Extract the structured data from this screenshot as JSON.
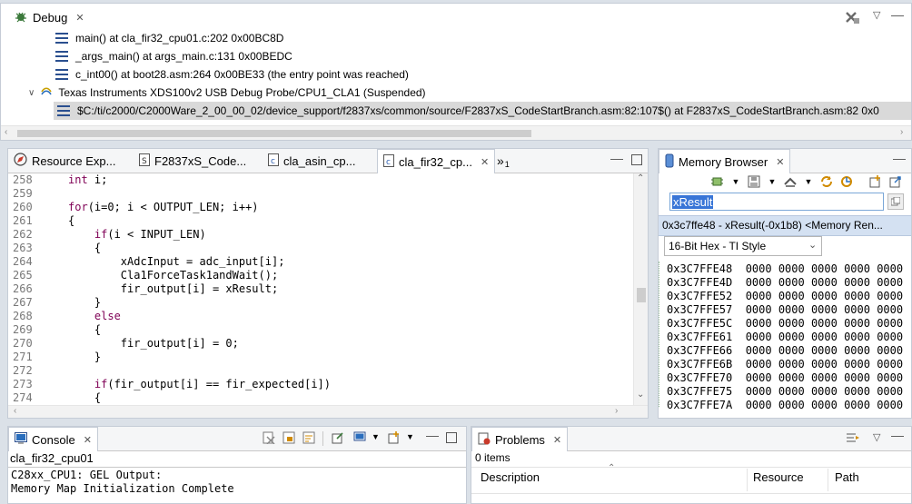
{
  "debug": {
    "tab_label": "Debug",
    "frames": [
      "main() at cla_fir32_cpu01.c:202 0x00BC8D",
      "_args_main() at args_main.c:131 0x00BEDC",
      "c_int00() at boot28.asm:264 0x00BE33  (the entry point was reached)"
    ],
    "probe_label": "Texas Instruments XDS100v2 USB Debug Probe/CPU1_CLA1 (Suspended)",
    "selected_frame": "$C:/ti/c2000/C2000Ware_2_00_00_02/device_support/f2837xs/common/source/F2837xS_CodeStartBranch.asm:82:107$() at F2837xS_CodeStartBranch.asm:82 0x0"
  },
  "editor": {
    "tabs": [
      "Resource Exp...",
      "F2837xS_Code...",
      "cla_asin_cp...",
      "cla_fir32_cp..."
    ],
    "overflow_label": "»",
    "overflow_count": "1",
    "lines": [
      {
        "n": "258",
        "code": "int i;"
      },
      {
        "n": "259",
        "code": ""
      },
      {
        "n": "260",
        "code": "for(i=0; i < OUTPUT_LEN; i++)"
      },
      {
        "n": "261",
        "code": "{"
      },
      {
        "n": "262",
        "code": "    if(i < INPUT_LEN)"
      },
      {
        "n": "263",
        "code": "    {"
      },
      {
        "n": "264",
        "code": "        xAdcInput = adc_input[i];"
      },
      {
        "n": "265",
        "code": "        Cla1ForceTask1andWait();"
      },
      {
        "n": "266",
        "code": "        fir_output[i] = xResult;"
      },
      {
        "n": "267",
        "code": "    }"
      },
      {
        "n": "268",
        "code": "    else"
      },
      {
        "n": "269",
        "code": "    {"
      },
      {
        "n": "270",
        "code": "        fir_output[i] = 0;"
      },
      {
        "n": "271",
        "code": "    }"
      },
      {
        "n": "272",
        "code": ""
      },
      {
        "n": "273",
        "code": "    if(fir_output[i] == fir_expected[i])"
      },
      {
        "n": "274",
        "code": "    {"
      }
    ]
  },
  "memory": {
    "tab_label": "Memory Browser",
    "search_value": "xResult",
    "location_label": "0x3c7ffe48 - xResult(-0x1b8) <Memory Ren...",
    "format": "16-Bit Hex - TI Style",
    "rows": [
      {
        "addr": "0x3C7FFE48",
        "data": "0000 0000 0000 0000 0000"
      },
      {
        "addr": "0x3C7FFE4D",
        "data": "0000 0000 0000 0000 0000"
      },
      {
        "addr": "0x3C7FFE52",
        "data": "0000 0000 0000 0000 0000"
      },
      {
        "addr": "0x3C7FFE57",
        "data": "0000 0000 0000 0000 0000"
      },
      {
        "addr": "0x3C7FFE5C",
        "data": "0000 0000 0000 0000 0000"
      },
      {
        "addr": "0x3C7FFE61",
        "data": "0000 0000 0000 0000 0000"
      },
      {
        "addr": "0x3C7FFE66",
        "data": "0000 0000 0000 0000 0000"
      },
      {
        "addr": "0x3C7FFE6B",
        "data": "0000 0000 0000 0000 0000"
      },
      {
        "addr": "0x3C7FFE70",
        "data": "0000 0000 0000 0000 0000"
      },
      {
        "addr": "0x3C7FFE75",
        "data": "0000 0000 0000 0000 0000"
      },
      {
        "addr": "0x3C7FFE7A",
        "data": "0000 0000 0000 0000 0000"
      }
    ]
  },
  "console": {
    "tab_label": "Console",
    "session": "cla_fir32_cpu01",
    "lines": [
      "C28xx_CPU1: GEL Output:",
      "Memory Map Initialization Complete"
    ]
  },
  "problems": {
    "tab_label": "Problems",
    "count": "0 items",
    "columns": [
      "Description",
      "Resource",
      "Path"
    ]
  },
  "colors": {
    "keyword": "#7f0055",
    "selection": "#d9d9d9",
    "search_highlight": "#3875d7"
  }
}
